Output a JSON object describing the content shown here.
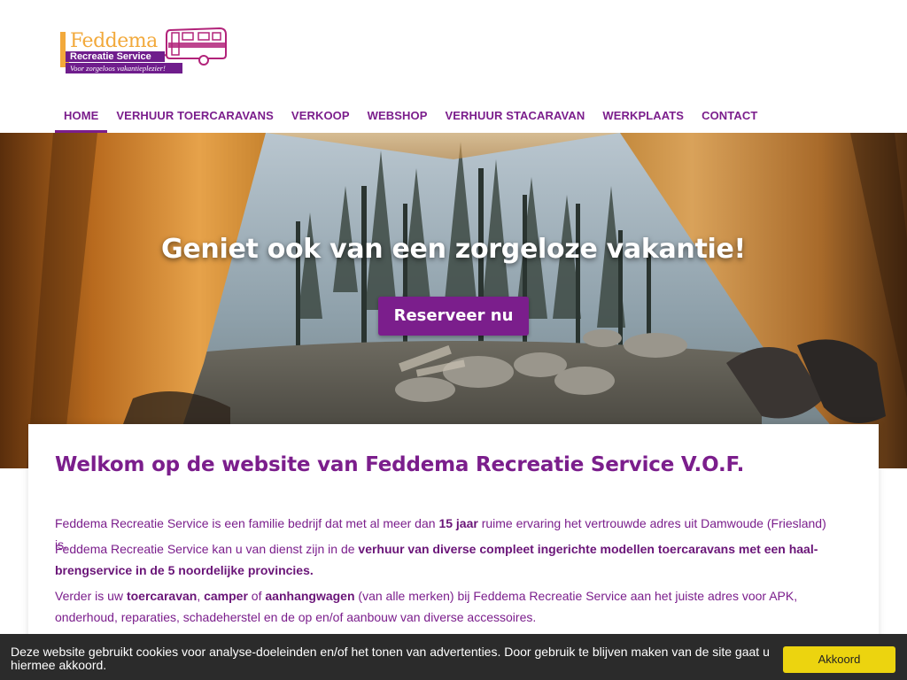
{
  "brand": {
    "name_line1": "Feddema",
    "name_line2": "Recreatie Service",
    "tagline": "Voor zorgeloos vakantieplezier!",
    "colors": {
      "primary": "#7b1e8c",
      "accent": "#f2a93b"
    }
  },
  "nav": {
    "items": [
      {
        "label": "HOME",
        "active": true
      },
      {
        "label": "VERHUUR TOERCARAVANS",
        "active": false
      },
      {
        "label": "VERKOOP",
        "active": false
      },
      {
        "label": "WEBSHOP",
        "active": false
      },
      {
        "label": "VERHUUR STACARAVAN",
        "active": false
      },
      {
        "label": "WERKPLAATS",
        "active": false
      },
      {
        "label": "CONTACT",
        "active": false
      }
    ]
  },
  "hero": {
    "title": "Geniet ook van een zorgeloze vakantie!",
    "cta": "Reserveer nu"
  },
  "content": {
    "heading": "Welkom op de website van Feddema Recreatie Service V.O.F.",
    "p1": {
      "a": "Feddema Recreatie Service is een familie bedrijf dat met al meer dan ",
      "b": "15 jaar",
      "c": " ruime ervaring het vertrouwde adres uit Damwoude (Friesland) is."
    },
    "p2": {
      "a": "Feddema Recreatie Service kan u van dienst zijn in de ",
      "b": "verhuur van diverse compleet ingerichte modellen toercaravans met een haal-brengservice in de 5 noordelijke provincies."
    },
    "p3": {
      "a": "Verder is uw ",
      "b": "toercaravan",
      "c": ", ",
      "d": "camper",
      "e": " of ",
      "f": "aanhangwagen",
      "g": " (van alle merken) bij Feddema Recreatie Service aan het juiste adres voor APK, onderhoud, reparaties, schadeherstel en de op en/of aanbouw van diverse accessoires."
    }
  },
  "cookie": {
    "text": "Deze website gebruikt cookies voor analyse-doeleinden en/of het tonen van advertenties. Door gebruik te blijven maken van de site gaat u hiermee akkoord.",
    "button": "Akkoord"
  }
}
